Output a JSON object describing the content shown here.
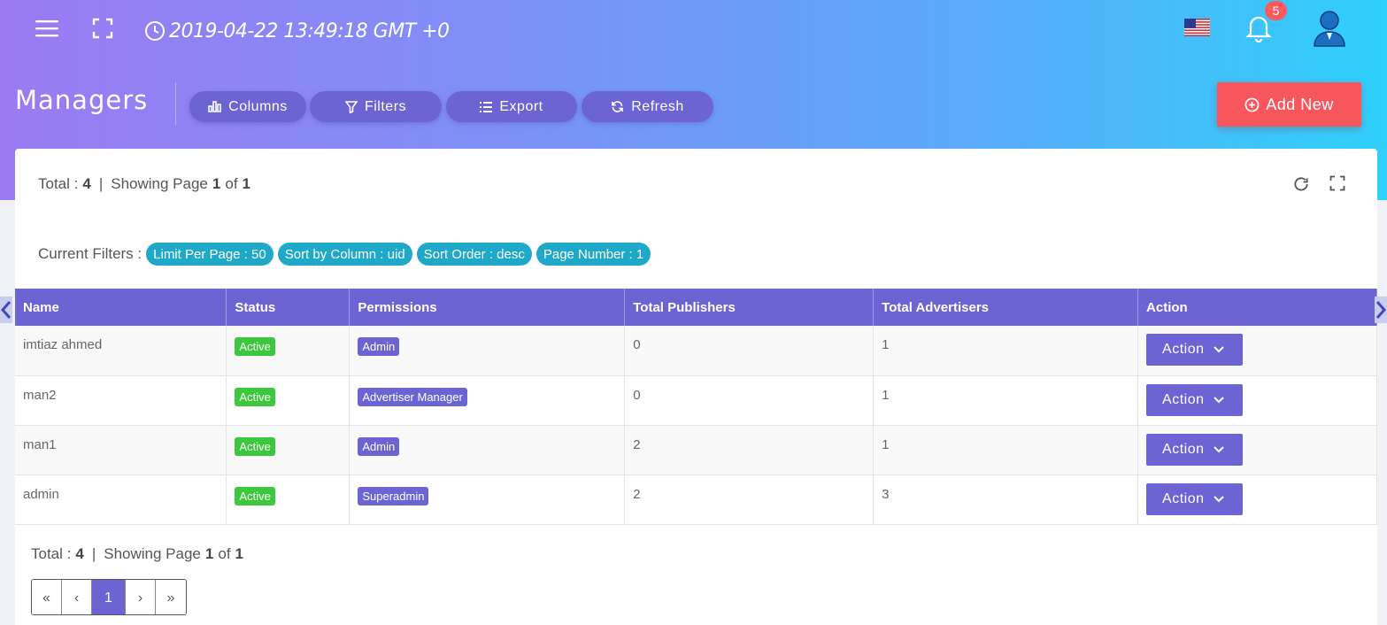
{
  "topbar": {
    "datetime": "2019-04-22 13:49:18 GMT +0",
    "notification_count": "5"
  },
  "header": {
    "title": "Managers",
    "buttons": {
      "columns": "Columns",
      "filters": "Filters",
      "export": "Export",
      "refresh": "Refresh"
    },
    "add_new": "Add New"
  },
  "summary": {
    "total_label": "Total :",
    "total": "4",
    "sep": "|",
    "showing_label": "Showing Page",
    "page": "1",
    "of_label": "of",
    "pages": "1"
  },
  "filters": {
    "label": "Current Filters :",
    "chips": [
      "Limit Per Page : 50",
      "Sort by Column : uid",
      "Sort Order : desc",
      "Page Number : 1"
    ]
  },
  "table": {
    "columns": [
      "Name",
      "Status",
      "Permissions",
      "Total Publishers",
      "Total Advertisers",
      "Action"
    ],
    "rows": [
      {
        "name": "imtiaz ahmed",
        "status": "Active",
        "permission": "Admin",
        "publishers": "0",
        "advertisers": "1",
        "action": "Action"
      },
      {
        "name": "man2",
        "status": "Active",
        "permission": "Advertiser Manager",
        "publishers": "0",
        "advertisers": "1",
        "action": "Action"
      },
      {
        "name": "man1",
        "status": "Active",
        "permission": "Admin",
        "publishers": "2",
        "advertisers": "1",
        "action": "Action"
      },
      {
        "name": "admin",
        "status": "Active",
        "permission": "Superadmin",
        "publishers": "2",
        "advertisers": "3",
        "action": "Action"
      }
    ]
  },
  "pagination": {
    "first": "«",
    "prev": "‹",
    "current": "1",
    "next": "›",
    "last": "»"
  },
  "colors": {
    "accent": "#6c64d2",
    "add_new": "#f7565c",
    "chip": "#20a8c8",
    "active": "#3cc83c"
  }
}
